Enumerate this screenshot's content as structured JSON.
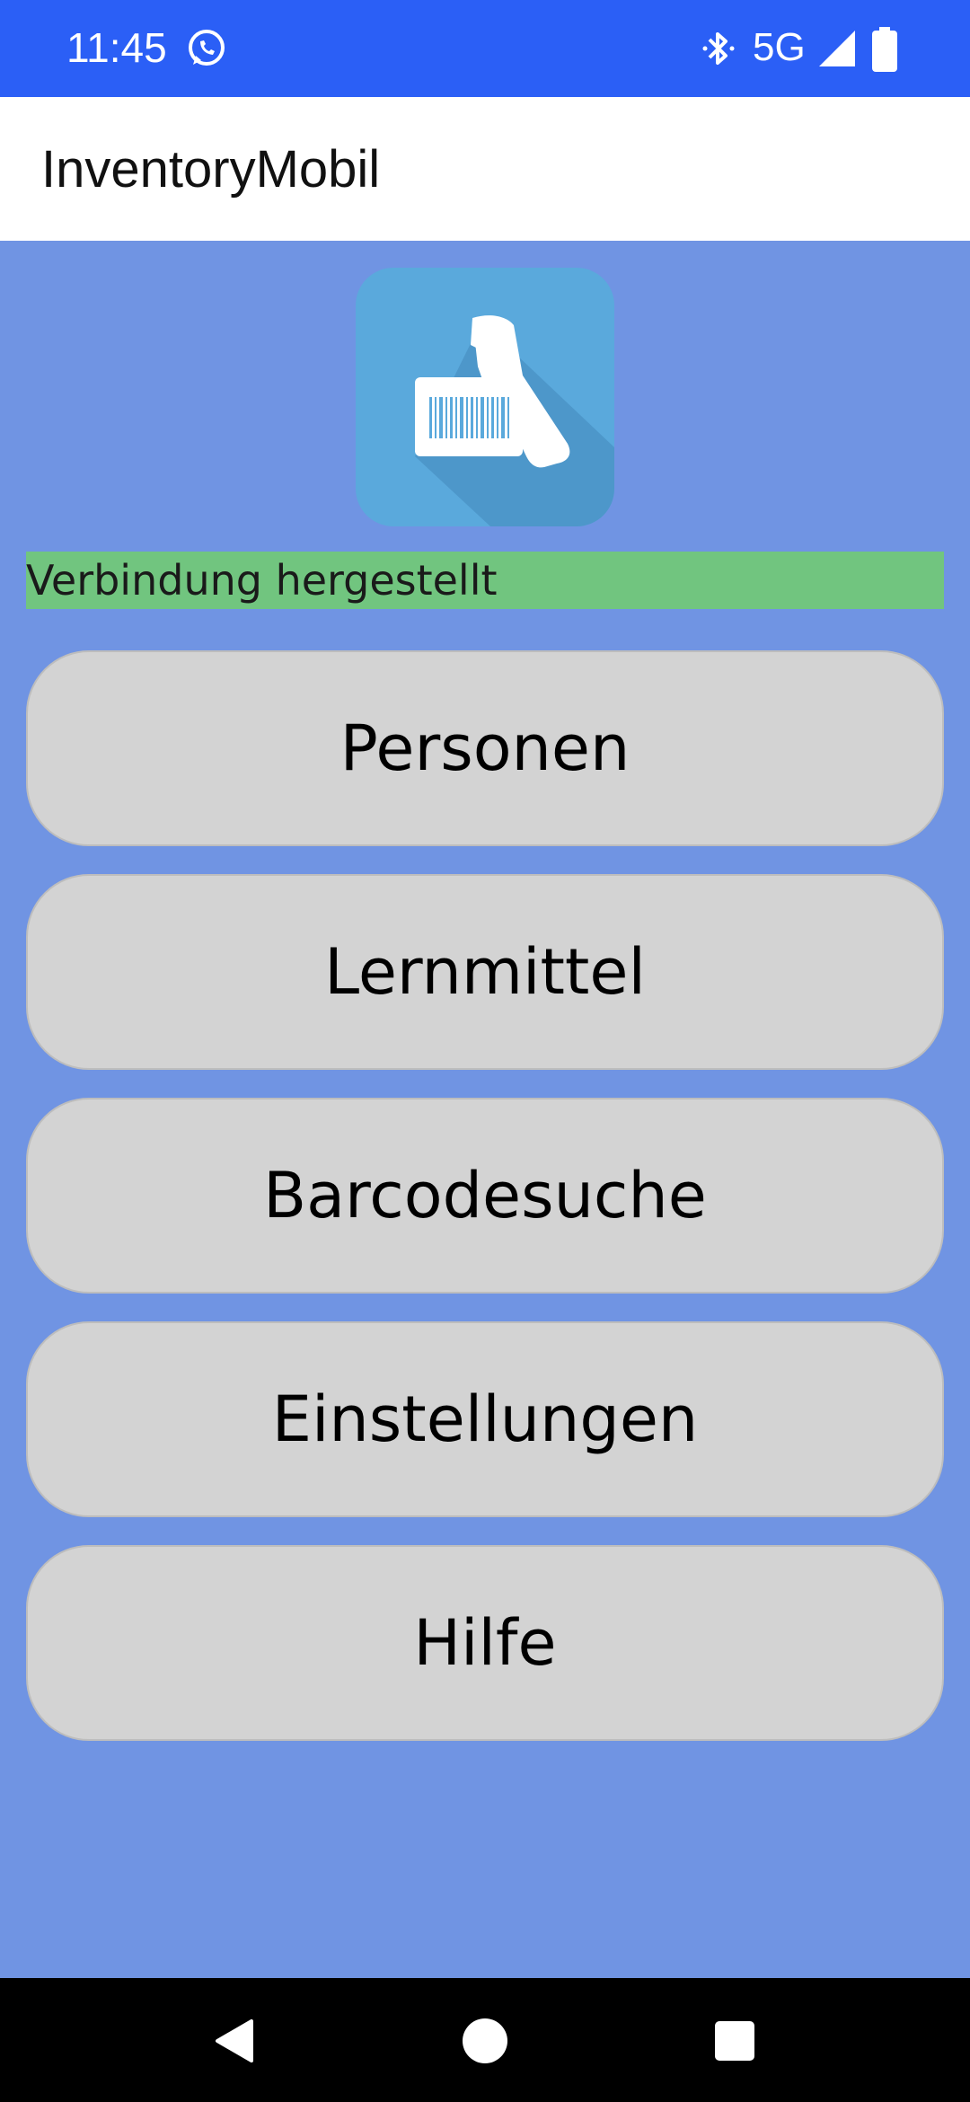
{
  "status_bar": {
    "time": "11:45",
    "network": "5G",
    "icons": [
      "whatsapp-icon",
      "bluetooth-icon",
      "signal-icon",
      "battery-icon"
    ]
  },
  "app_bar": {
    "title": "InventoryMobil"
  },
  "logo": {
    "icon": "barcode-scanner-icon",
    "background": "#5aa9dc"
  },
  "connection_status": {
    "text": "Verbindung hergestellt",
    "color": "#71c57f"
  },
  "menu": {
    "items": [
      {
        "label": "Personen"
      },
      {
        "label": "Lernmittel"
      },
      {
        "label": "Barcodesuche"
      },
      {
        "label": "Einstellungen"
      },
      {
        "label": "Hilfe"
      }
    ]
  },
  "nav_bar": {
    "icons": [
      "back-icon",
      "home-icon",
      "recents-icon"
    ]
  },
  "colors": {
    "status_bar": "#2b5ff6",
    "page_background": "#7094e3",
    "button_background": "#d3d3d3"
  }
}
